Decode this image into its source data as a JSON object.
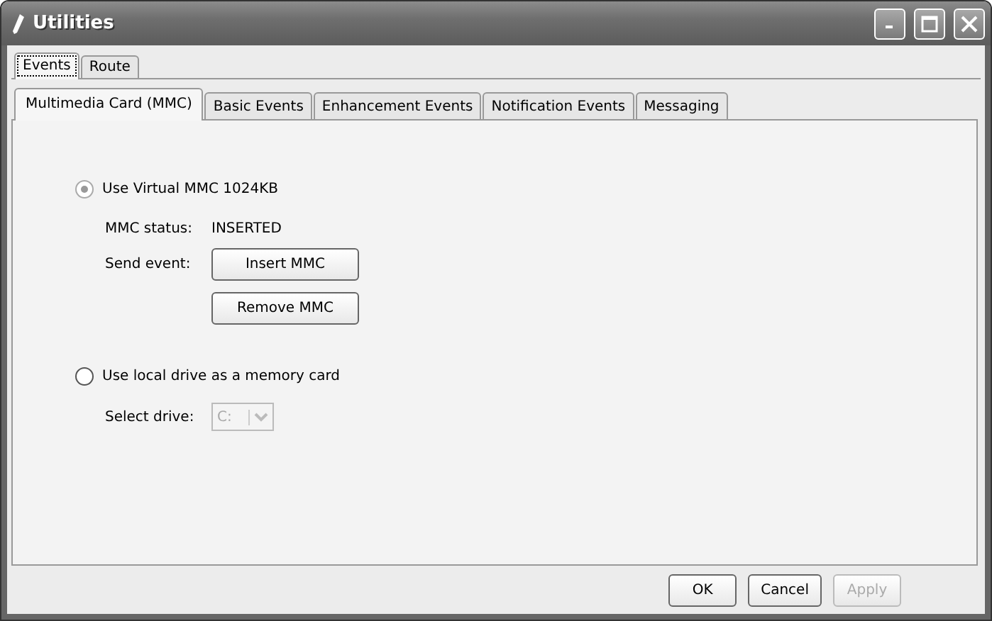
{
  "window": {
    "title": "Utilities"
  },
  "outer_tabs": [
    {
      "label": "Events",
      "selected": true
    },
    {
      "label": "Route",
      "selected": false
    }
  ],
  "inner_tabs": [
    {
      "label": "Multimedia Card (MMC)",
      "selected": true
    },
    {
      "label": "Basic Events",
      "selected": false
    },
    {
      "label": "Enhancement Events",
      "selected": false
    },
    {
      "label": "Notification Events",
      "selected": false
    },
    {
      "label": "Messaging",
      "selected": false
    }
  ],
  "virtual_option": {
    "label": "Use Virtual MMC 1024KB",
    "selected": true,
    "disabled": true
  },
  "status": {
    "label": "MMC status:",
    "value": "INSERTED"
  },
  "send_event": {
    "label": "Send event:",
    "buttons": [
      "Insert MMC",
      "Remove MMC"
    ]
  },
  "local_option": {
    "label": "Use local drive as a memory card",
    "selected": false,
    "disabled": false
  },
  "drive": {
    "label": "Select drive:",
    "value": "C:",
    "disabled": true
  },
  "dialog_buttons": [
    {
      "label": "OK",
      "disabled": false
    },
    {
      "label": "Cancel",
      "disabled": false
    },
    {
      "label": "Apply",
      "disabled": true
    }
  ]
}
